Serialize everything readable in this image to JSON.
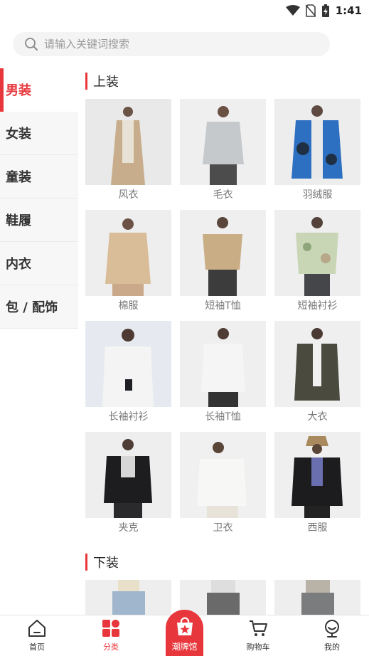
{
  "status_bar": {
    "time": "1:41",
    "icons": [
      "wifi-icon",
      "no-sim-icon",
      "battery-charging-icon"
    ]
  },
  "search": {
    "placeholder": "请输入关键词搜索",
    "icon": "search-icon"
  },
  "sidebar": {
    "items": [
      {
        "label": "男装",
        "active": true
      },
      {
        "label": "女装",
        "active": false
      },
      {
        "label": "童装",
        "active": false
      },
      {
        "label": "鞋履",
        "active": false
      },
      {
        "label": "内衣",
        "active": false
      },
      {
        "label": "包 / 配饰",
        "active": false
      }
    ]
  },
  "content": {
    "sections": [
      {
        "title": "上装",
        "items": [
          {
            "label": "风衣"
          },
          {
            "label": "毛衣"
          },
          {
            "label": "羽绒服"
          },
          {
            "label": "棉服"
          },
          {
            "label": "短袖T恤"
          },
          {
            "label": "短袖衬衫"
          },
          {
            "label": "长袖衬衫"
          },
          {
            "label": "长袖T恤"
          },
          {
            "label": "大衣"
          },
          {
            "label": "夹克"
          },
          {
            "label": "卫衣"
          },
          {
            "label": "西服"
          }
        ]
      },
      {
        "title": "下装",
        "items": [
          {
            "label": ""
          },
          {
            "label": ""
          },
          {
            "label": ""
          }
        ]
      }
    ]
  },
  "tabbar": {
    "tabs": [
      {
        "label": "首页",
        "icon": "home-icon"
      },
      {
        "label": "分类",
        "icon": "category-grid-icon",
        "active": true
      },
      {
        "label": "潮牌馆",
        "icon": "brand-bag-icon",
        "center": true
      },
      {
        "label": "购物车",
        "icon": "cart-icon"
      },
      {
        "label": "我的",
        "icon": "profile-icon"
      }
    ]
  },
  "colors": {
    "accent": "#e8373c",
    "sidebar_bg": "#f7f7f7",
    "search_bg": "#f4f4f4"
  }
}
